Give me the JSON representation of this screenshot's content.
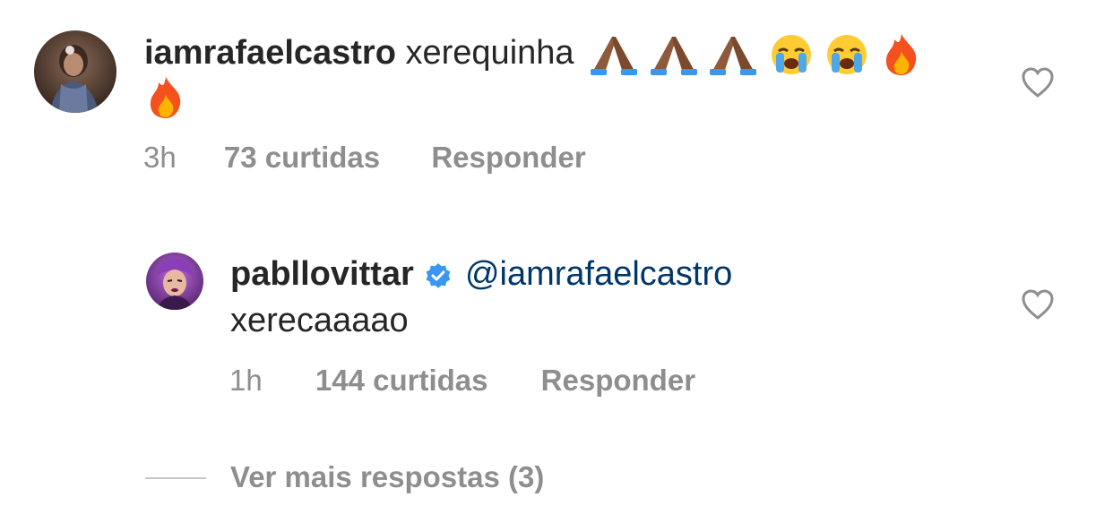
{
  "comments": [
    {
      "username": "iamrafaelcastro",
      "text": "xerequinha",
      "emojis_line1": [
        "folded-hands",
        "folded-hands",
        "folded-hands",
        "crying-face",
        "crying-face",
        "fire"
      ],
      "emojis_line2": [
        "fire"
      ],
      "time": "3h",
      "likes": "73 curtidas",
      "reply_label": "Responder"
    },
    {
      "username": "pabllovittar",
      "verified": true,
      "mention": "@iamrafaelcastro",
      "text": "xerecaaaao",
      "time": "1h",
      "likes": "144 curtidas",
      "reply_label": "Responder"
    }
  ],
  "view_more": "Ver mais respostas (3)",
  "colors": {
    "text": "#262626",
    "meta": "#8e8e8e",
    "mention": "#00376b",
    "verified": "#3897f0"
  }
}
